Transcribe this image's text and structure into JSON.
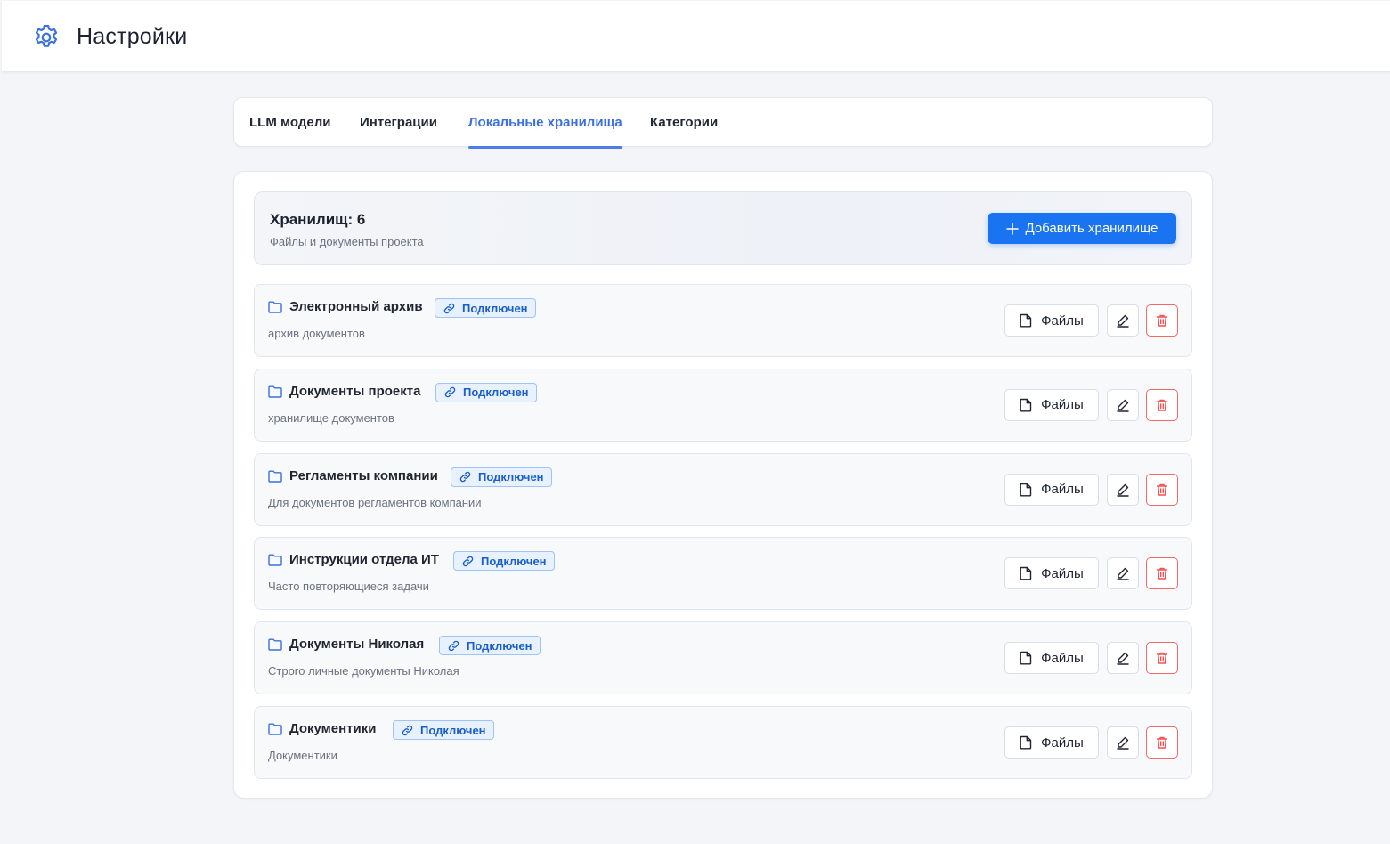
{
  "header": {
    "title": "Настройки",
    "icon": "gear-icon",
    "accent": "#3b6fe0"
  },
  "tabs": [
    {
      "label": "LLM модели",
      "active": false
    },
    {
      "label": "Интеграции",
      "active": false
    },
    {
      "label": "Локальные хранилища",
      "active": true
    },
    {
      "label": "Категории",
      "active": false
    }
  ],
  "summary": {
    "count_label": "Хранилищ: 6",
    "description": "Файлы и документы проекта",
    "add_button": "Добавить хранилище"
  },
  "storages": [
    {
      "name": "Электронный архив",
      "status": "Подключен",
      "description": "архив документов",
      "files_label": "Файлы"
    },
    {
      "name": "Документы проекта",
      "status": "Подключен",
      "description": "хранилище документов",
      "files_label": "Файлы"
    },
    {
      "name": "Регламенты компании",
      "status": "Подключен",
      "description": "Для документов регламентов компании",
      "files_label": "Файлы"
    },
    {
      "name": "Инструкции отдела ИТ",
      "status": "Подключен",
      "description": "Часто повторяющиеся задачи",
      "files_label": "Файлы"
    },
    {
      "name": "Документы Николая",
      "status": "Подключен",
      "description": "Строго личные документы Николая",
      "files_label": "Файлы"
    },
    {
      "name": "Документики",
      "status": "Подключен",
      "description": "Документики",
      "files_label": "Файлы"
    }
  ],
  "colors": {
    "primary": "#1a73f0",
    "badge_bg": "#e7f1ff",
    "danger": "#ef6b6b"
  }
}
